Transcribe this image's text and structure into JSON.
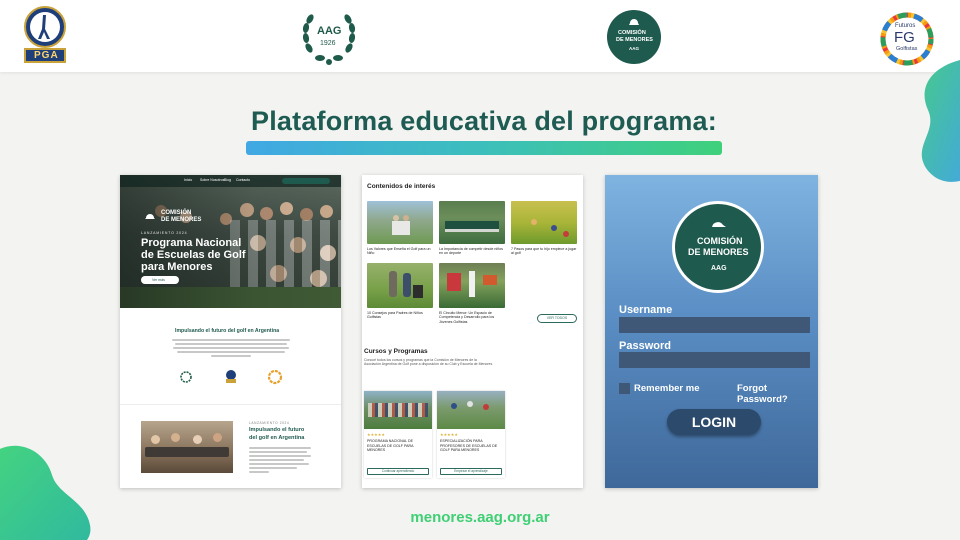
{
  "header": {
    "logos": [
      {
        "name": "pga-logo",
        "text": "PGA"
      },
      {
        "name": "aag-logo",
        "text": "AAG",
        "year": "1926"
      },
      {
        "name": "comision-menores-logo",
        "line1": "COMISIÓN",
        "line2": "DE MENORES",
        "line3": "AAG"
      },
      {
        "name": "futuros-golfistas-logo",
        "top": "Futuros",
        "mid": "FG",
        "bottom": "Golfistas"
      }
    ]
  },
  "headline": "Plataforma educativa del programa:",
  "site_preview": {
    "nav": [
      "Inicio",
      "Sobre Nosotros",
      "Blog",
      "Contacto"
    ],
    "brand_line1": "COMISIÓN",
    "brand_line2": "DE MENORES",
    "kicker": "LANZAMIENTO 2024",
    "hero_title_line1": "Programa Nacional",
    "hero_title_line2": "de Escuelas de Golf",
    "hero_title_line3": "para Menores",
    "hero_button": "Ver más",
    "section_title": "Impulsando el futuro del golf en Argentina",
    "feature_kicker": "LANZAMIENTO 2024",
    "feature_title_line1": "Impulsando el futuro",
    "feature_title_line2": "del golf en Argentina"
  },
  "content_preview": {
    "title": "Contenidos de interés",
    "articles": [
      "Los Valores que Enseña el Golf para un Niño",
      "La Importancia de competir desde niños en un deporte",
      "7 Pasos para que tu hijo empiece a jugar al golf",
      "10 Consejos para Padres de Niños Golfistas",
      "El Circuito Menor: Un Espacio de Competencia y Desarrollo para los Jóvenes Golfistas"
    ],
    "see_all": "VER TODOS",
    "courses_title": "Cursos y Programas",
    "courses_intro": "Conocé todos los cursos y programas que la Comisión de Menores de la Asociación Argentina de Golf pone a disposición de su Club y Escuela de Menores",
    "courses": [
      {
        "title": "PROGRAMA NACIONAL DE ESCUELAS DE GOLF PARA MENORES",
        "button": "Continuar aprendiendo"
      },
      {
        "title": "ESPECIALIZACIÓN PARA PROFESORES DE ESCUELAS DE GOLF PARA MENORES",
        "button": "Empezar el aprendizaje"
      }
    ]
  },
  "login": {
    "logo_line1": "COMISIÓN",
    "logo_line2": "DE MENORES",
    "logo_line3": "AAG",
    "username_label": "Username",
    "password_label": "Password",
    "remember_label": "Remember me",
    "forgot_label": "Forgot Password?",
    "button": "LOGIN"
  },
  "url": "menores.aag.org.ar",
  "colors": {
    "brand_green": "#1e5b52",
    "accent_green": "#3fcf74",
    "accent_blue": "#41a8e4"
  }
}
